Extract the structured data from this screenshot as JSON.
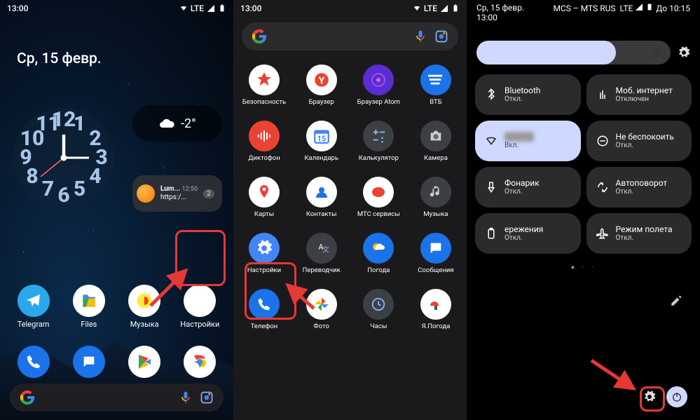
{
  "status": {
    "time": "13:00",
    "lte": "LTE",
    "wifi": "▾"
  },
  "home": {
    "date": "Ср, 15 февр.",
    "weather_temp": "-2°",
    "notif": {
      "title": "Lum...",
      "time": "12:50",
      "subtitle": "https:/...",
      "badge": "2"
    },
    "apps": [
      {
        "label": "Telegram",
        "color": "#29a9eb"
      },
      {
        "label": "Files",
        "color": "#4285f4"
      },
      {
        "label": "Музыка",
        "color": "#ff3d00"
      },
      {
        "label": "Настройки",
        "color": "#4285f4"
      }
    ],
    "fabs": [
      "phone",
      "messages",
      "play",
      "chrome"
    ]
  },
  "drawer": {
    "rows": [
      [
        {
          "l": "Безопасность",
          "c": "#fff"
        },
        {
          "l": "Браузер",
          "c": "#fff"
        },
        {
          "l": "Браузер Atom",
          "c": "#5b2dd1"
        },
        {
          "l": "ВТБ",
          "c": "#1a73e8"
        }
      ],
      [
        {
          "l": "Диктофон",
          "c": "#ea4335"
        },
        {
          "l": "Календарь",
          "c": "#fff"
        },
        {
          "l": "Калькулятор",
          "c": "#3c4043"
        },
        {
          "l": "Камера",
          "c": "#3c4043"
        }
      ],
      [
        {
          "l": "Карты",
          "c": "#fff"
        },
        {
          "l": "Контакты",
          "c": "#fff"
        },
        {
          "l": "МТС сервисы",
          "c": "#fff"
        },
        {
          "l": "Музыка",
          "c": "#3c4043"
        }
      ],
      [
        {
          "l": "Настройки",
          "c": "#4285f4"
        },
        {
          "l": "Переводчик",
          "c": "#3c4043"
        },
        {
          "l": "Погода",
          "c": "#1a73e8"
        },
        {
          "l": "Сообщения",
          "c": "#1a73e8"
        }
      ],
      [
        {
          "l": "Телефон",
          "c": "#1a73e8"
        },
        {
          "l": "Фото",
          "c": "#fff"
        },
        {
          "l": "Часы",
          "c": "#3c4043"
        },
        {
          "l": "Я.Погода",
          "c": "#fff"
        }
      ]
    ]
  },
  "qs": {
    "date": "Ср, 15 февр.",
    "time": "13:00",
    "carrier": "MCS – MTS RUS",
    "lte": "LTE",
    "alarm": "До 10:15",
    "tiles": [
      {
        "title": "Bluetooth",
        "sub": "Откл.",
        "active": false,
        "icon": "bt"
      },
      {
        "title": "Моб. интернет",
        "sub": "Отключен",
        "active": false,
        "icon": "data"
      },
      {
        "title": "",
        "sub": "Вкл.",
        "active": true,
        "icon": "wifi",
        "blur": true
      },
      {
        "title": "Не беспокоить",
        "sub": "Откл.",
        "active": false,
        "icon": "dnd"
      },
      {
        "title": "Фонарик",
        "sub": "Откл.",
        "active": false,
        "icon": "flash"
      },
      {
        "title": "Автоповорот",
        "sub": "Откл.",
        "active": false,
        "icon": "rotate"
      },
      {
        "title": "ережения",
        "sub": "Откл.",
        "active": false,
        "icon": "battery"
      },
      {
        "title": "Режим полета",
        "sub": "Откл.",
        "active": false,
        "icon": "plane"
      }
    ]
  }
}
